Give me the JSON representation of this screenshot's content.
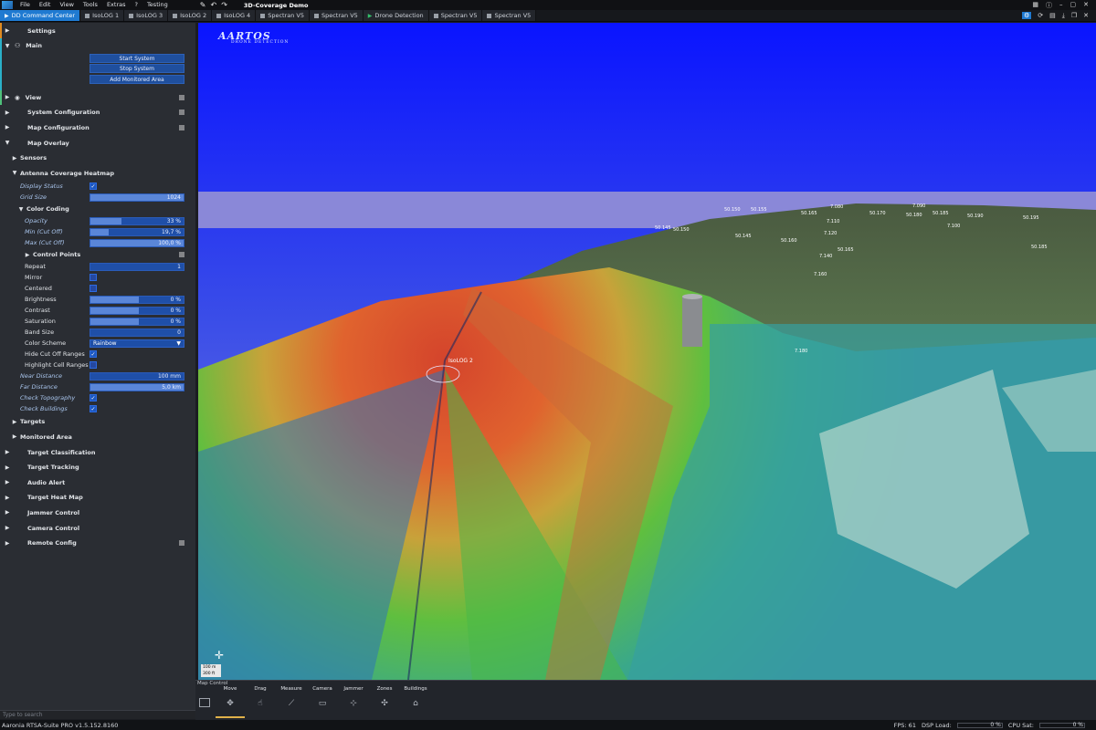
{
  "menubar": {
    "items": [
      "File",
      "Edit",
      "View",
      "Tools",
      "Extras",
      "?",
      "Testing"
    ],
    "doc_title": "3D-Coverage Demo"
  },
  "tabs": [
    {
      "label": "DD Command Center",
      "active": true,
      "icon": "play"
    },
    {
      "label": "IsoLOG 1",
      "icon": "square"
    },
    {
      "label": "IsoLOG 3",
      "icon": "square"
    },
    {
      "label": "IsoLOG 2",
      "icon": "square"
    },
    {
      "label": "IsoLOG 4",
      "icon": "square"
    },
    {
      "label": "Spectran V5",
      "icon": "square"
    },
    {
      "label": "Spectran V5",
      "icon": "square"
    },
    {
      "label": "Drone Detection",
      "icon": "play"
    },
    {
      "label": "Spectran V5",
      "icon": "square"
    },
    {
      "label": "Spectran V5",
      "icon": "square"
    }
  ],
  "panel": {
    "settings": "Settings",
    "main": "Main",
    "start_system": "Start System",
    "stop_system": "Stop System",
    "add_monitored_area": "Add Monitored Area",
    "view": "View",
    "system_configuration": "System Configuration",
    "map_configuration": "Map Configuration",
    "map_overlay": "Map Overlay",
    "sensors": "Sensors",
    "antenna_heatmap": "Antenna Coverage Heatmap",
    "display_status": "Display Status",
    "grid_size": "Grid Size",
    "grid_size_value": "1024",
    "color_coding": "Color Coding",
    "opacity": "Opacity",
    "opacity_value": "33 %",
    "opacity_fraction": 0.33,
    "min_cut_off": "Min (Cut Off)",
    "min_cut_off_value": "19,7 %",
    "min_cut_off_fraction": 0.197,
    "max_cut_off": "Max (Cut Off)",
    "max_cut_off_value": "100,0 %",
    "control_points": "Control Points",
    "repeat": "Repeat",
    "repeat_value": "1",
    "mirror": "Mirror",
    "centered": "Centered",
    "brightness": "Brightness",
    "brightness_value": "0 %",
    "contrast": "Contrast",
    "contrast_value": "0 %",
    "saturation": "Saturation",
    "saturation_value": "0 %",
    "band_size": "Band Size",
    "band_size_value": "0",
    "color_scheme": "Color Scheme",
    "color_scheme_value": "Rainbow",
    "hide_cut_off_ranges": "Hide Cut Off Ranges",
    "highlight_cell_ranges": "Highlight Cell Ranges",
    "near_distance": "Near Distance",
    "near_distance_value": "100 mm",
    "far_distance": "Far Distance",
    "far_distance_value": "5,0 km",
    "check_topography": "Check Topography",
    "check_buildings": "Check Buildings",
    "targets": "Targets",
    "monitored_area": "Monitored Area",
    "target_classification": "Target Classification",
    "target_tracking": "Target Tracking",
    "audio_alert": "Audio Alert",
    "target_heat_map": "Target Heat Map",
    "jammer_control": "Jammer Control",
    "camera_control": "Camera Control",
    "remote_config": "Remote Config",
    "search_placeholder": "Type to search"
  },
  "map": {
    "logo_text": "AARTOS",
    "logo_sub": "DRONE DETECTION",
    "sensor_label": "IsoLOG 2",
    "scale_top": "100 m",
    "scale_bottom": "300 ft",
    "grid_labels": [
      "50.145",
      "50.150",
      "50.155",
      "50.160",
      "50.165",
      "50.170",
      "50.175",
      "50.180",
      "50.185",
      "50.190",
      "50.195",
      "7.080",
      "7.090",
      "7.100",
      "7.110",
      "7.120",
      "7.140",
      "7.160",
      "7.180"
    ]
  },
  "map_control": {
    "title": "Map Control",
    "tools": [
      {
        "label": "Move",
        "icon": "✥",
        "active": true
      },
      {
        "label": "Drag",
        "icon": "☝"
      },
      {
        "label": "Measure",
        "icon": "⟋"
      },
      {
        "label": "Camera",
        "icon": "▭"
      },
      {
        "label": "Jammer",
        "icon": "⊹"
      },
      {
        "label": "Zones",
        "icon": "✣"
      },
      {
        "label": "Buildings",
        "icon": "⌂"
      }
    ]
  },
  "status": {
    "version": "Aaronia RTSA-Suite PRO v1.5.152.8160",
    "fps": "FPS: 61",
    "dsp_load_label": "DSP Load:",
    "dsp_load_value": "0 %",
    "cpu_sat_label": "CPU Sat:",
    "cpu_sat_value": "0 %"
  },
  "colors": {
    "accent": "#1f7ad1",
    "panel_bg": "#2a2d33",
    "control_blue": "#1f4fa8",
    "settings_accent": "#e08a20",
    "main_accent": "#2ab0c8",
    "view_accent": "#4ec07a"
  }
}
